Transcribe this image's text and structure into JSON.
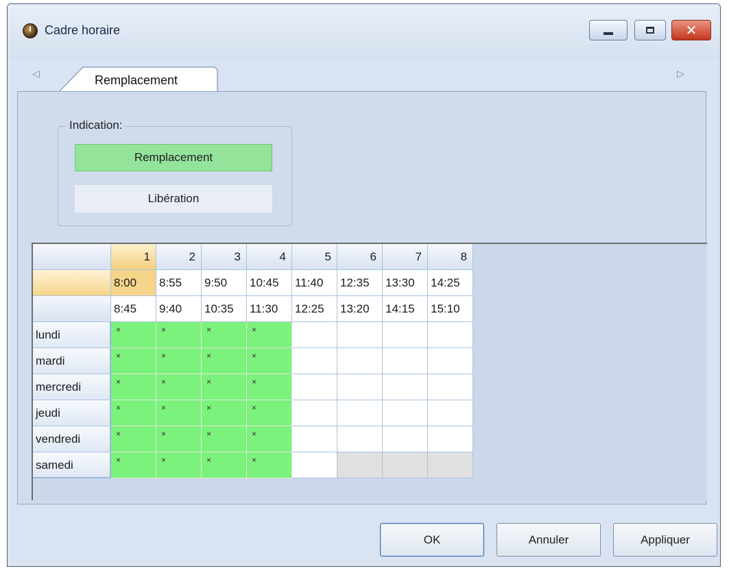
{
  "window": {
    "title": "Cadre horaire",
    "icon": "clock-icon"
  },
  "tabs": [
    {
      "label": "Remplacement",
      "active": true
    }
  ],
  "indication": {
    "legend": "Indication:",
    "options": [
      {
        "label": "Remplacement",
        "color": "#93e39b"
      },
      {
        "label": "Libération",
        "color": "#e9eef6"
      }
    ]
  },
  "grid": {
    "periods": [
      "1",
      "2",
      "3",
      "4",
      "5",
      "6",
      "7",
      "8"
    ],
    "start_times": [
      "8:00",
      "8:55",
      "9:50",
      "10:45",
      "11:40",
      "12:35",
      "13:30",
      "14:25"
    ],
    "end_times": [
      "8:45",
      "9:40",
      "10:35",
      "11:30",
      "12:25",
      "13:20",
      "14:15",
      "15:10"
    ],
    "days": [
      "lundi",
      "mardi",
      "mercredi",
      "jeudi",
      "vendredi",
      "samedi"
    ],
    "cells": [
      [
        "×",
        "×",
        "×",
        "×",
        "",
        "",
        "",
        ""
      ],
      [
        "×",
        "×",
        "×",
        "×",
        "",
        "",
        "",
        ""
      ],
      [
        "×",
        "×",
        "×",
        "×",
        "",
        "",
        "",
        ""
      ],
      [
        "×",
        "×",
        "×",
        "×",
        "",
        "",
        "",
        ""
      ],
      [
        "×",
        "×",
        "×",
        "×",
        "",
        "",
        "",
        ""
      ],
      [
        "×",
        "×",
        "×",
        "×",
        "",
        "",
        "",
        ""
      ]
    ],
    "states": [
      [
        "on",
        "on",
        "on",
        "on",
        "",
        "",
        "",
        ""
      ],
      [
        "on",
        "on",
        "on",
        "on",
        "",
        "",
        "",
        ""
      ],
      [
        "on",
        "on",
        "on",
        "on",
        "",
        "",
        "",
        ""
      ],
      [
        "on",
        "on",
        "on",
        "on",
        "",
        "",
        "",
        ""
      ],
      [
        "on",
        "on",
        "on",
        "on",
        "",
        "",
        "",
        ""
      ],
      [
        "on",
        "on",
        "on",
        "on",
        "",
        "off",
        "off",
        "off"
      ]
    ],
    "colors": {
      "replacement": "#7bf27c",
      "disabled": "#e0e0e0",
      "selected": "#f6d58a"
    }
  },
  "buttons": {
    "ok": "OK",
    "cancel": "Annuler",
    "apply": "Appliquer"
  }
}
